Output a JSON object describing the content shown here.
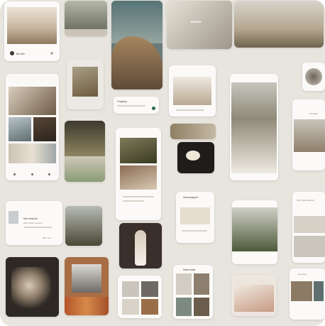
{
  "texts": {
    "card_a_user": "Bo Ma",
    "card_b_brand": "BRAND",
    "card_c_title": "Faqang",
    "card_d_title": "Wa restiole",
    "card_d_sub": "Wos prdas mosome",
    "card_d_meta": "MB - GG",
    "card_e_title": "Swousagoh",
    "card_f_title": "Nbemmbt",
    "card_g_title": "Ww Pollid wiltasolf",
    "card_h_title": "Swowale",
    "card_i_title": "Ans waet"
  },
  "colors": {
    "board_bg": "#e8e5df",
    "card_bg": "#f4f2ee",
    "accent_green": "#2f6b4a"
  },
  "icons": [
    "back-icon",
    "chevron-right-icon",
    "play-icon",
    "heart-icon",
    "search-icon",
    "menu-icon"
  ]
}
